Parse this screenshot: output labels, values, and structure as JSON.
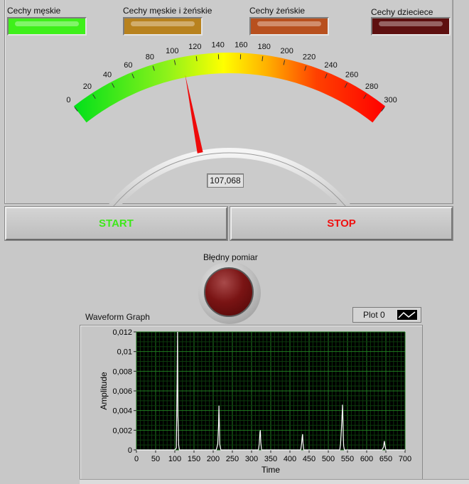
{
  "indicators": [
    {
      "label": "Cechy męskie",
      "color": "#3ef01a"
    },
    {
      "label": "Cechy męskie i żeńskie",
      "color": "#b8821e"
    },
    {
      "label": "Cechy żeńskie",
      "color": "#b8501e"
    },
    {
      "label": "Cechy dzieciece",
      "color": "#5e1010"
    }
  ],
  "gauge": {
    "min": 0,
    "max": 300,
    "ticks": [
      "0",
      "20",
      "40",
      "60",
      "80",
      "100",
      "120",
      "140",
      "160",
      "180",
      "200",
      "220",
      "240",
      "260",
      "280",
      "300"
    ],
    "value": 107.068,
    "value_display": "107,068"
  },
  "buttons": {
    "start_label": "START",
    "start_color": "#3ee81a",
    "stop_label": "STOP",
    "stop_color": "#f01010"
  },
  "led": {
    "label": "Błędny pomiar",
    "color": "#7a1414"
  },
  "waveform": {
    "title": "Waveform Graph",
    "legend_label": "Plot 0"
  },
  "chart_data": {
    "type": "line",
    "title": "Waveform Graph",
    "xlabel": "Time",
    "ylabel": "Amplitude",
    "xlim": [
      0,
      700
    ],
    "ylim": [
      0,
      0.012
    ],
    "x_ticks": [
      "0",
      "50",
      "100",
      "150",
      "200",
      "250",
      "300",
      "350",
      "400",
      "450",
      "500",
      "550",
      "600",
      "650",
      "700"
    ],
    "y_ticks": [
      "0",
      "0,002",
      "0,004",
      "0,006",
      "0,008",
      "0,01",
      "0,012"
    ],
    "grid": true,
    "series": [
      {
        "name": "Plot 0",
        "x": [
          0,
          100,
          104,
          106,
          107,
          108,
          109,
          110,
          112,
          115,
          208,
          212,
          214,
          215,
          216,
          217,
          220,
          318,
          320,
          322,
          323,
          324,
          326,
          428,
          430,
          432,
          433,
          434,
          436,
          530,
          532,
          534,
          536,
          537,
          538,
          539,
          540,
          542,
          544,
          640,
          644,
          646,
          648,
          650,
          700
        ],
        "y": [
          0,
          0,
          0.0002,
          0.007,
          0.012,
          0.0035,
          0.0024,
          0.0005,
          0,
          0,
          0,
          0.0006,
          0.0025,
          0.0045,
          0.0028,
          0.0006,
          0,
          0,
          0.0006,
          0.0018,
          0.002,
          0.0008,
          0,
          0,
          0.0005,
          0.0013,
          0.0016,
          0.0007,
          0,
          0,
          0.0006,
          0.002,
          0.0036,
          0.0046,
          0.0032,
          0.0014,
          0.0004,
          0,
          0,
          0,
          0.0003,
          0.0009,
          0.0004,
          0,
          0
        ]
      }
    ]
  }
}
